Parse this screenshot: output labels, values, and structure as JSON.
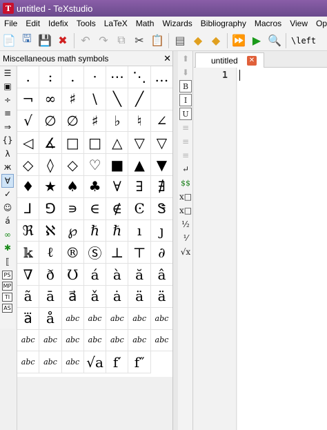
{
  "window": {
    "title": "untitled - TeXstudio",
    "icon_glyph": "T"
  },
  "menu": [
    "File",
    "Edit",
    "Idefix",
    "Tools",
    "LaTeX",
    "Math",
    "Wizards",
    "Bibliography",
    "Macros",
    "View",
    "Op"
  ],
  "toolbar": {
    "buttons": [
      {
        "name": "new-file-icon",
        "glyph": "📄",
        "color": "#2a8a2a"
      },
      {
        "name": "open-file-icon",
        "glyph": "🖫",
        "color": "#3a6fb0"
      },
      {
        "name": "save-icon",
        "glyph": "💾",
        "color": "#2a4f8a"
      },
      {
        "name": "close-file-icon",
        "glyph": "✖",
        "color": "#d02020"
      },
      {
        "name": "undo-icon",
        "glyph": "↶",
        "color": "#a8a8a8"
      },
      {
        "name": "redo-icon",
        "glyph": "↷",
        "color": "#a8a8a8"
      },
      {
        "name": "copy-icon",
        "glyph": "⧉",
        "color": "#a8a8a8"
      },
      {
        "name": "cut-icon",
        "glyph": "✂",
        "color": "#333333"
      },
      {
        "name": "paste-icon",
        "glyph": "📋",
        "color": "#333333"
      },
      {
        "name": "log-icon",
        "glyph": "▤",
        "color": "#555555"
      },
      {
        "name": "bookmark-prev-icon",
        "glyph": "◆",
        "color": "#e0a020"
      },
      {
        "name": "bookmark-next-icon",
        "glyph": "◆",
        "color": "#e0a020"
      },
      {
        "name": "build-view-icon",
        "glyph": "⏩",
        "color": "#1a9a1a"
      },
      {
        "name": "compile-icon",
        "glyph": "▶",
        "color": "#1a9a1a"
      },
      {
        "name": "view-pdf-icon",
        "glyph": "🔍",
        "color": "#3a6fb0"
      }
    ],
    "left_text": "\\left"
  },
  "panel": {
    "title": "Miscellaneous math symbols",
    "close": "✕"
  },
  "sidebar": [
    {
      "name": "structure-icon",
      "glyph": "☰",
      "active": false
    },
    {
      "name": "bookmarks-icon",
      "glyph": "▣",
      "active": false
    },
    {
      "name": "operators-icon",
      "glyph": "÷",
      "active": false
    },
    {
      "name": "relations-icon",
      "glyph": "≡",
      "active": false
    },
    {
      "name": "arrows-icon",
      "glyph": "⇒",
      "active": false
    },
    {
      "name": "delimiters-icon",
      "glyph": "{}",
      "active": false
    },
    {
      "name": "greek-icon",
      "glyph": "λ",
      "active": false
    },
    {
      "name": "cyrillic-icon",
      "glyph": "ж",
      "active": false
    },
    {
      "name": "misc-math-icon",
      "glyph": "∀",
      "active": true
    },
    {
      "name": "check-icon",
      "glyph": "✓",
      "active": false
    },
    {
      "name": "smiley-icon",
      "glyph": "☺",
      "active": false
    },
    {
      "name": "accent-icon",
      "glyph": "á",
      "active": false
    },
    {
      "name": "infinity-icon",
      "glyph": "∞",
      "active": false,
      "green": true
    },
    {
      "name": "asterisk-icon",
      "glyph": "✱",
      "active": false,
      "green": true
    },
    {
      "name": "double-bracket-icon",
      "glyph": "⟦",
      "active": false
    },
    {
      "name": "ps-icon",
      "glyph": "PS",
      "active": false,
      "box": true
    },
    {
      "name": "mp-icon",
      "glyph": "MP",
      "active": false,
      "box": true
    },
    {
      "name": "ti-icon",
      "glyph": "TI",
      "active": false,
      "box": true
    },
    {
      "name": "as-icon",
      "glyph": "AS",
      "active": false,
      "box": true
    }
  ],
  "symbols": [
    ".",
    ":",
    ".",
    "·",
    "⋯",
    "⋱",
    "…",
    "¬",
    "∞",
    "♯",
    "\\",
    "╲",
    "╱",
    "",
    "√",
    "∅",
    "∅",
    "♯",
    "♭",
    "♮",
    "∠",
    "◁",
    "∡",
    "□",
    "□",
    "△",
    "▽",
    "▽",
    "◇",
    "◊",
    "◇",
    "♡",
    "■",
    "▲",
    "▼",
    "♦",
    "★",
    "♠",
    "♣",
    "∀",
    "∃",
    "∄",
    "⅃",
    "⅁",
    "∍",
    "∈",
    "∉",
    "Ͼ",
    "Ꮥ",
    "ℜ",
    "ℵ",
    "℘",
    "ℏ",
    "ℏ",
    "ı",
    "ȷ",
    "𝕜",
    "ℓ",
    "®",
    "Ⓢ",
    "⊥",
    "⊤",
    "∂",
    "∇",
    "ð",
    "Ʊ",
    "á",
    "à",
    "ă",
    "â",
    "ã",
    "ā",
    "a⃗",
    "ǎ",
    "ȧ",
    "ä",
    "ä",
    "a⃛",
    "å",
    "abc",
    "abc",
    "abc",
    "abc",
    "abc",
    "abc",
    "abc",
    "abc",
    "abc",
    "abc",
    "abc",
    "abc",
    "abc",
    "abc",
    "abc",
    "√a",
    "f′",
    "f″",
    ""
  ],
  "editor": {
    "tab_label": "untitled",
    "tab_close": "✕",
    "line_number": "1"
  },
  "editbar": [
    {
      "name": "editbar-arrow-up-icon",
      "glyph": "⬆",
      "dim": true
    },
    {
      "name": "editbar-arrow-down-icon",
      "glyph": "⬇",
      "dim": true
    },
    {
      "name": "bold-icon",
      "glyph": "B",
      "boxed": true
    },
    {
      "name": "italic-icon",
      "glyph": "I",
      "boxed": true
    },
    {
      "name": "underline-icon",
      "glyph": "U",
      "boxed": true
    },
    {
      "name": "align-left-icon",
      "glyph": "≡",
      "dim": true
    },
    {
      "name": "align-center-icon",
      "glyph": "≡",
      "dim": true
    },
    {
      "name": "align-right-icon",
      "glyph": "≡",
      "dim": true
    },
    {
      "name": "newline-icon",
      "glyph": "↵",
      "dim": false
    },
    {
      "name": "math-dollar-icon",
      "glyph": "$$",
      "green": true
    },
    {
      "name": "subscript-icon",
      "glyph": "x□",
      "dim": false
    },
    {
      "name": "superscript-icon",
      "glyph": "x□",
      "dim": false
    },
    {
      "name": "fraction-icon",
      "glyph": "½",
      "dim": false
    },
    {
      "name": "dfrac-icon",
      "glyph": "⅟",
      "dim": false
    },
    {
      "name": "sqrt-icon",
      "glyph": "√x",
      "dim": false
    }
  ]
}
